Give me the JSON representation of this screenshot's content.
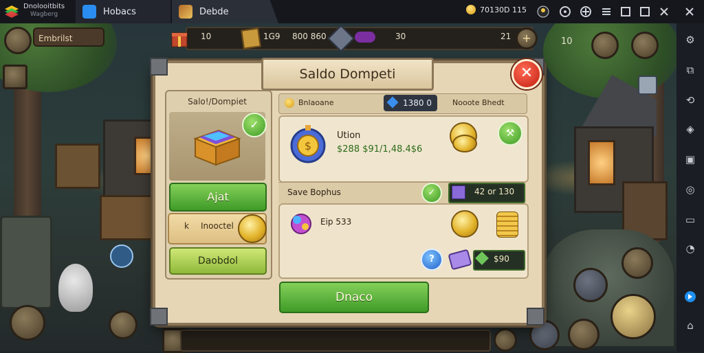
{
  "emulator": {
    "app_name": "Dnolooitbits",
    "app_sub": "Wagberg",
    "tabs": [
      {
        "label": "Hobacs"
      },
      {
        "label": "Debde"
      }
    ],
    "coin_readout": "70130D 115",
    "controls": [
      "account-icon",
      "help-icon",
      "settings-icon",
      "minimize-icon",
      "maximize-icon",
      "close-icon",
      "collapse-icon"
    ]
  },
  "sidebar": {
    "icons": [
      "gear-icon",
      "screenshot-icon",
      "rotate-icon",
      "volume-icon",
      "apk-icon",
      "location-icon",
      "folder-icon",
      "macro-icon",
      "bluestacks-icon",
      "home-icon"
    ]
  },
  "hud": {
    "profile_chip": "Embrilst",
    "top_left_value": "10",
    "top_mid_value": "1G9",
    "top_gold_value": "800 860",
    "top_gem_value": "30",
    "top_right_value": "21",
    "far_right_value": "10"
  },
  "dialog": {
    "title": "Saldo Dompeti",
    "close_label": "✕",
    "left_panel": {
      "header": "Salo!/Dompiet",
      "button_primary": "Ajat",
      "product_prefix": "k",
      "product_label": "Inooctel",
      "button_secondary": "Daobdol"
    },
    "subheader": {
      "balance_label": "Bnlaoane",
      "gem_value": "1380 0",
      "note": "Nooote Bhedt"
    },
    "main_card": {
      "title": "Ution",
      "amount": "$288 $91/1,48.4$6"
    },
    "section": {
      "title": "Save Bophus",
      "chip_value": "42 or 130"
    },
    "secondary_card": {
      "item_label": "Eip 533",
      "chip_value": "$90"
    },
    "confirm_button": "Dnaco"
  },
  "colors": {
    "accent_green": "#4aa82c",
    "close_red": "#d62a17",
    "panel_parchment": "#e6d6b6",
    "gold": "#e2b32a"
  }
}
